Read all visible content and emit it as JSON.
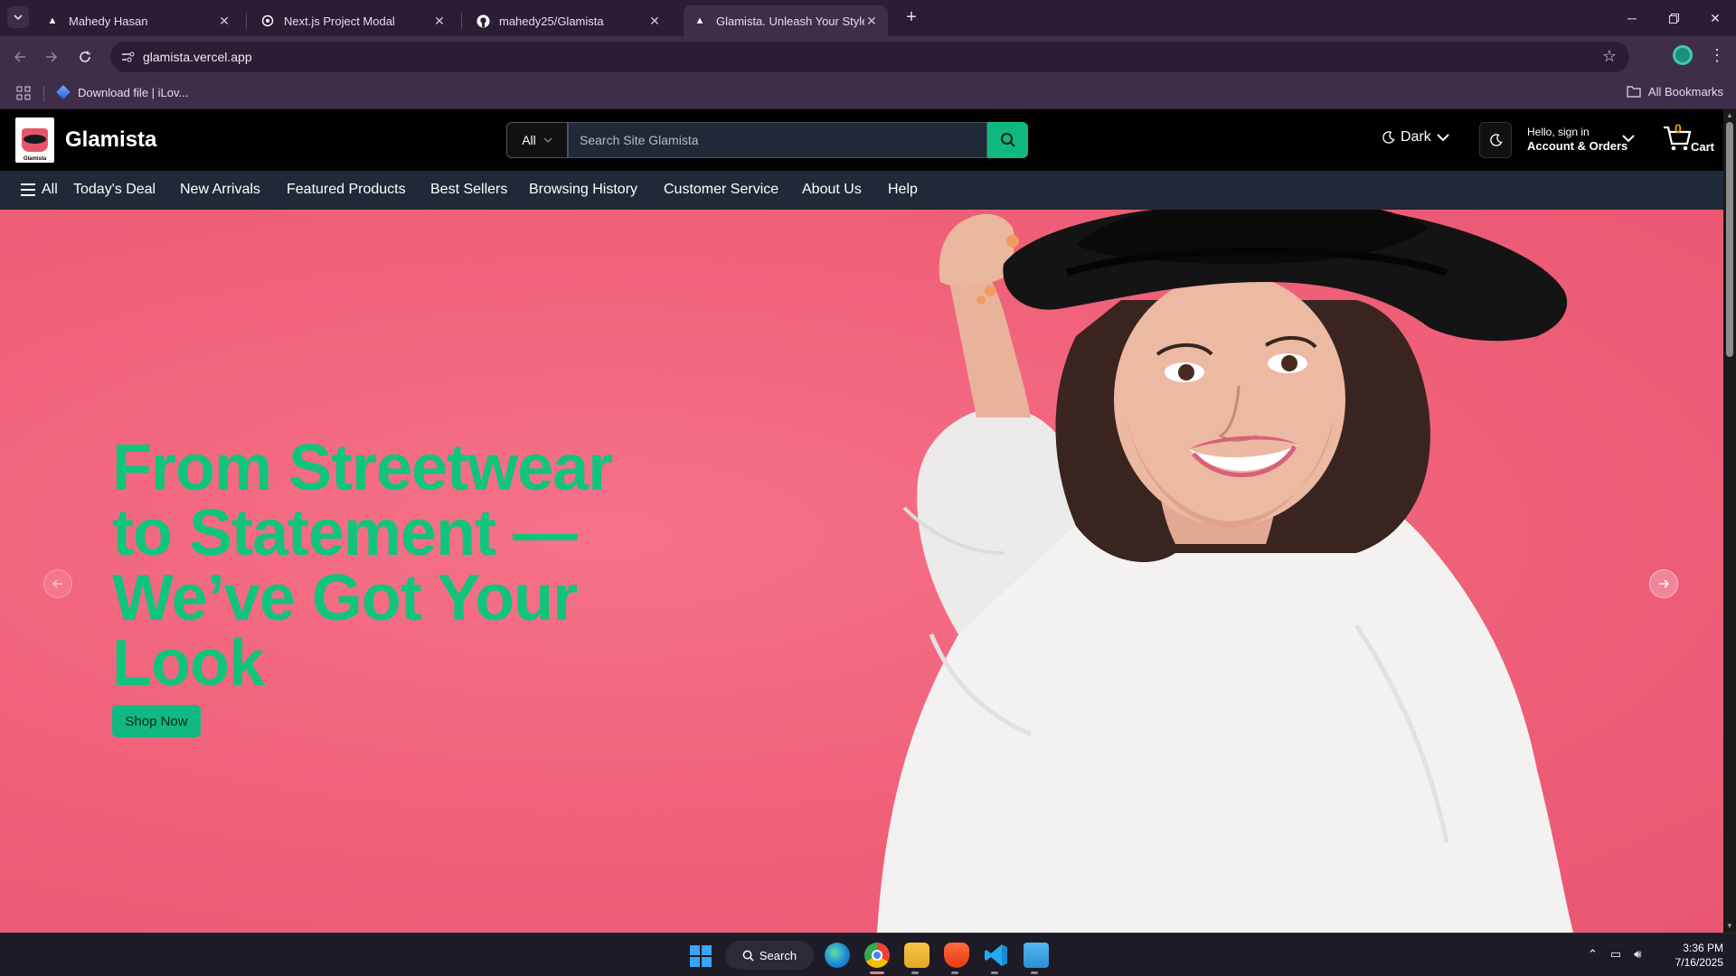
{
  "browser": {
    "tabs": [
      {
        "title": "Mahedy Hasan",
        "icon": "vercel-icon",
        "active": false
      },
      {
        "title": "Next.js Project Modal",
        "icon": "openai-icon",
        "active": false
      },
      {
        "title": "mahedy25/Glamista",
        "icon": "github-icon",
        "active": false
      },
      {
        "title": "Glamista. Unleash Your Style —",
        "icon": "vercel-icon",
        "active": true
      }
    ],
    "url": "glamista.vercel.app",
    "bookmarks": [
      {
        "label": "Download file | iLov..."
      }
    ],
    "all_bookmarks": "All Bookmarks"
  },
  "site": {
    "brand": "Glamista",
    "logo_caption": "Glamista",
    "search": {
      "category": "All",
      "placeholder": "Search Site Glamista"
    },
    "theme": {
      "label": "Dark"
    },
    "account": {
      "hello": "Hello, sign in",
      "orders": "Account & Orders"
    },
    "cart": {
      "count": "0",
      "label": "Cart"
    },
    "nav": {
      "all": "All",
      "items": [
        "Today's Deal",
        "New Arrivals",
        "Featured Products",
        "Best Sellers",
        "Browsing History",
        "Customer Service",
        "About Us",
        "Help"
      ]
    },
    "hero": {
      "title": "From Streetwear to Statement — We’ve Got Your Look",
      "button": "Shop Now",
      "background_color": "#f1607a",
      "accent_color": "#10c47c"
    }
  },
  "taskbar": {
    "search": "Search",
    "time": "3:36 PM",
    "date": "7/16/2025"
  }
}
